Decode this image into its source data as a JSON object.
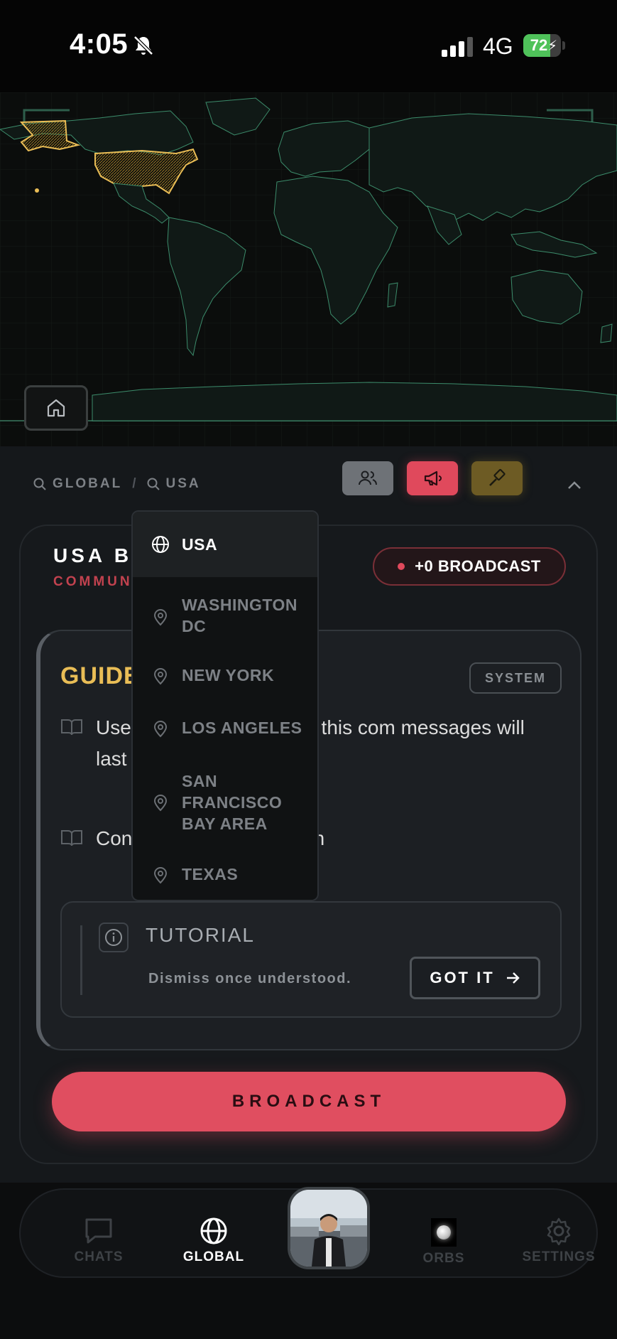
{
  "status_bar": {
    "time": "4:05",
    "network": "4G",
    "battery_level": "72",
    "battery_fraction": 0.72,
    "battery_color": "#4fc25a"
  },
  "map": {
    "highlighted_region": "USA",
    "highlight_color": "#e9bd56",
    "border_color": "#3c8c6b"
  },
  "breadcrumb": {
    "level_1": "GLOBAL",
    "separator": "/",
    "level_2": "USA"
  },
  "toolbar": {
    "people_icon": "people-icon",
    "broadcast_icon": "megaphone-icon",
    "moderation_icon": "hammer-icon"
  },
  "card": {
    "title": "USA B",
    "subtitle": "COMMUN",
    "broadcast_count_label": "+0 BROADCAST"
  },
  "guide": {
    "title": "GUIDE",
    "badge": "SYSTEM",
    "rules": [
      {
        "icon": "book-icon",
        "text": "Use sages and photos to this com messages will last for 24 hour"
      },
      {
        "icon": "book-icon",
        "text": "Con ethical and legal stan"
      }
    ]
  },
  "tutorial": {
    "title": "TUTORIAL",
    "text": "Dismiss once understood.",
    "button_label": "GOT IT"
  },
  "broadcast_button_label": "BROADCAST",
  "dropdown": {
    "options": [
      {
        "label": "USA",
        "icon": "globe-icon",
        "selected": true
      },
      {
        "label": "WASHINGTON DC",
        "icon": "pin-icon",
        "selected": false
      },
      {
        "label": "NEW YORK",
        "icon": "pin-icon",
        "selected": false
      },
      {
        "label": "LOS ANGELES",
        "icon": "pin-icon",
        "selected": false
      },
      {
        "label": "SAN FRANCISCO BAY AREA",
        "icon": "pin-icon",
        "selected": false
      },
      {
        "label": "TEXAS",
        "icon": "pin-icon",
        "selected": false
      }
    ]
  },
  "nav": {
    "chats": "CHATS",
    "global": "GLOBAL",
    "orbs": "ORBS",
    "settings": "SETTINGS",
    "active": "global"
  },
  "colors": {
    "accent_red": "#e04e60",
    "accent_gold": "#e9bd56",
    "background": "#15181b"
  }
}
